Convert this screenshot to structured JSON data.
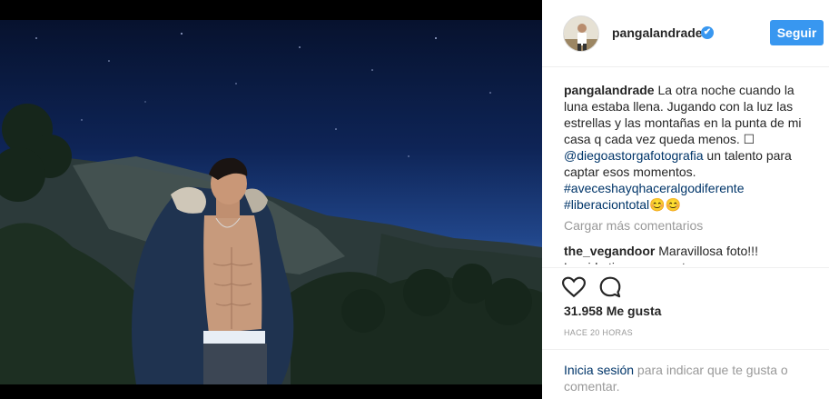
{
  "post": {
    "username": "pangalandrade",
    "verified_mark": "✔",
    "follow_label": "Seguir"
  },
  "caption": {
    "user": "pangalandrade",
    "text": "La otra noche cuando la luna estaba llena. Jugando con la luz las estrellas y las montañas en la punta de mi casa q cada vez queda menos. ☐",
    "mention": "@diegoastorgafotografia",
    "mention_text": " un talento para captar esos momentos.",
    "hashtag1": "#aveceshayqhaceralgodiferente",
    "hashtag2": "#liberaciontotal😊😊"
  },
  "load_more": "Cargar más comentarios",
  "comment": {
    "user": "the_vegandoor",
    "text": "Maravillosa foto!!! Permiso!",
    "cut_text": "La vida tiene momentos que @thevegandoor"
  },
  "actions": {
    "like_icon": "heart-icon",
    "comment_icon": "comment-icon"
  },
  "likes": "31.958 Me gusta",
  "time": "HACE 20 HORAS",
  "login": {
    "link": "Inicia sesión",
    "rest": " para indicar que te gusta o comentar."
  },
  "colors": {
    "accent": "#3897f0",
    "link": "#003569",
    "muted": "#999999",
    "text": "#262626"
  }
}
